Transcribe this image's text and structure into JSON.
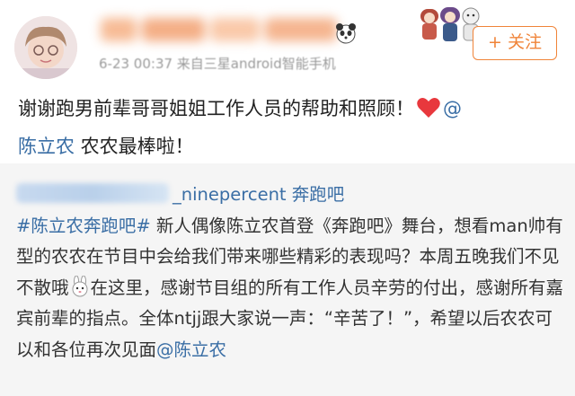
{
  "post": {
    "meta": "6-23 00:37  来自三星android智能手机",
    "follow_label": "+ 关注",
    "text_part1": "谢谢跑男前辈哥哥姐姐工作人员的帮助和照顾！",
    "mention_at": "@",
    "mention_name": "陈立农",
    "text_part2": " 农农最棒啦！",
    "icons": {
      "avatar": "avatar-photo",
      "heart": "heart-icon",
      "badge": "panda-emoji-icon",
      "sticker": "cartoon-sticker"
    }
  },
  "repost": {
    "source_name": "_ninepercent 奔跑吧",
    "hashtag": "#陈立农奔跑吧#",
    "body_part1": "   新人偶像陈立农首登《奔跑吧》舞台，想看man帅有型的农农在节目中会给我们带来哪些精彩的表现吗？本周五晚我们不见不散哦",
    "body_part2": "在这里，感谢节目组的所有工作人员辛劳的付出，感谢所有嘉宾前辈的指点。全体ntjj跟大家说一声：“辛苦了！”，希望以后农农可以和各位再次见面",
    "mention": "@陈立农",
    "icons": {
      "rabbit": "rabbit-emoji-icon"
    }
  },
  "colors": {
    "accent": "#f08439",
    "link": "#3a6ea5",
    "repost_bg": "#f5f5f5",
    "heart": "#e8383d"
  }
}
